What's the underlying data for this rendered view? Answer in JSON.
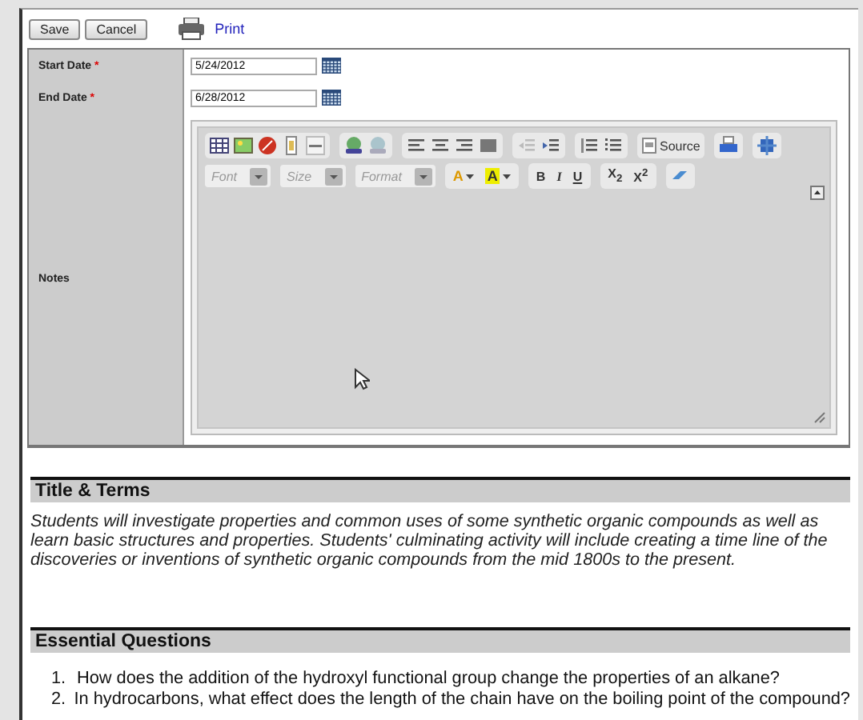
{
  "toolbar": {
    "buttons": [
      "Save",
      "Cancel"
    ],
    "print_link": "Print"
  },
  "form": {
    "fields": [
      {
        "label": "Start Date",
        "required_mark": "*",
        "value": "5/24/2012"
      },
      {
        "label": "End Date",
        "required_mark": "*",
        "value": "6/28/2012"
      }
    ],
    "notes": {
      "label": "Notes",
      "editor": {
        "source_button": "Source",
        "combos": [
          {
            "placeholder": "Font"
          },
          {
            "placeholder": "Size"
          },
          {
            "placeholder": "Format"
          }
        ],
        "color_buttons": [
          {
            "kind": "text_color",
            "glyph": "A"
          },
          {
            "kind": "background_color",
            "glyph": "A"
          }
        ],
        "style_buttons": [
          {
            "kind": "bold",
            "glyph": "B"
          },
          {
            "kind": "italic",
            "glyph": "I"
          },
          {
            "kind": "underline",
            "glyph": "U"
          }
        ],
        "script_buttons": [
          "X$_{2}$",
          "X$^{2}$"
        ]
      }
    }
  },
  "sections": [
    {
      "heading": "Title & Terms",
      "kind": "paragraph",
      "text": "Students will investigate properties and common uses of some synthetic organic compounds as well as learn basic structures and properties. Students' culminating activity will include creating a time line of the discoveries or inventions of synthetic organic compounds from the mid 1800s to the present."
    },
    {
      "heading": "Essential Questions",
      "kind": "numbered",
      "items": [
        {
          "number": "1.",
          "text": "How does the addition of the hydroxyl functional group change the properties of an alkane?"
        },
        {
          "number": "2.",
          "text": "In hydrocarbons, what effect does the length of the chain have on the boiling point of the compound?"
        }
      ]
    }
  ]
}
